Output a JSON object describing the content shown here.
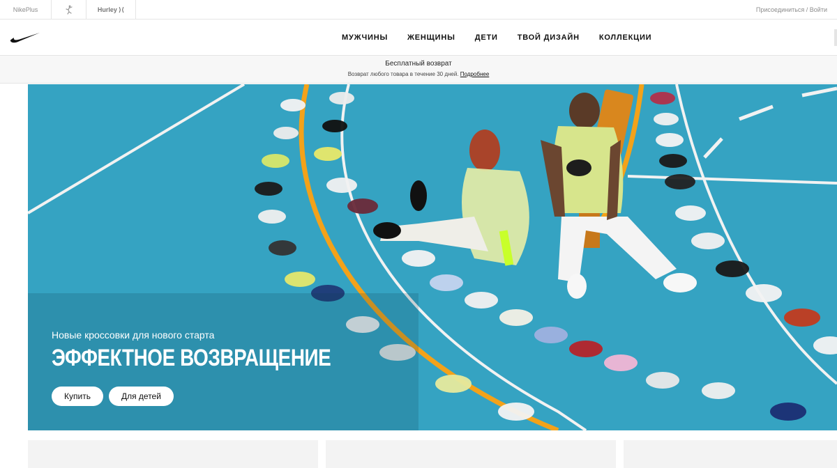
{
  "brand_bar": {
    "brands": [
      {
        "label": "NikePlus"
      },
      {
        "label": "",
        "icon": "jumpman-icon"
      },
      {
        "label": "Hurley"
      }
    ],
    "account_link": "Присоединиться / Войти"
  },
  "nav": {
    "logo": "nike-swoosh-icon",
    "links": [
      "МУЖЧИНЫ",
      "ЖЕНЩИНЫ",
      "ДЕТИ",
      "ТВОЙ ДИЗАЙН",
      "КОЛЛЕКЦИИ"
    ]
  },
  "promo": {
    "title": "Бесплатный возврат",
    "text": "Возврат любого товара в течение 30 дней.",
    "link": "Подробнее"
  },
  "hero": {
    "subtitle": "Новые кроссовки для нового старта",
    "title": "ЭФФЕКТНОЕ ВОЗВРАЩЕНИЕ",
    "buttons": [
      "Купить",
      "Для детей"
    ]
  },
  "colors": {
    "court": "#37a7c6",
    "court_line": "#f2f2f2",
    "court_orange": "#f3a21a"
  }
}
